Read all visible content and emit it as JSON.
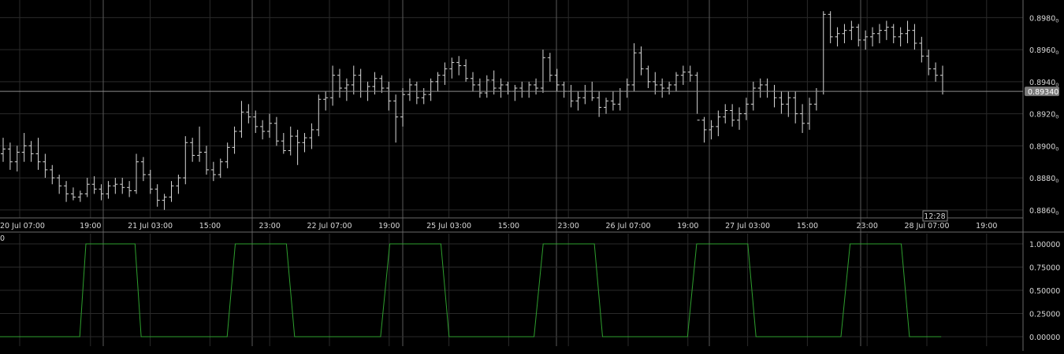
{
  "colors": {
    "background": "#000000",
    "grid": "#2a2a2a",
    "major_grid": "#5a5a5a",
    "bar": "#d8d8d8",
    "axis_text": "#d8d8d8",
    "indicator_line": "#2e9f2e",
    "price_tag_bg": "#7a7a7a",
    "crosshair": "#8a8a8a",
    "separator": "#6a6a6a"
  },
  "crosshair": {
    "price_label": "0.89340",
    "time_label": "12:28",
    "price": 0.8934
  },
  "price_panel": {
    "ylim": [
      0.8855,
      0.899
    ],
    "y_ticks": [
      "0.8980",
      "0.8960",
      "0.8940",
      "0.8920",
      "0.8900",
      "0.8880",
      "0.8860"
    ],
    "tick_suffix": "0"
  },
  "time_axis": {
    "labels": [
      "20 Jul 07:00",
      "19:00",
      "21 Jul 03:00",
      "15:00",
      "23:00",
      "22 Jul 07:00",
      "19:00",
      "25 Jul 03:00",
      "15:00",
      "23:00",
      "26 Jul 07:00",
      "19:00",
      "27 Jul 03:00",
      "15:00",
      "23:00",
      "28 Jul 07:00",
      "19:00"
    ]
  },
  "indicator_panel": {
    "corner_label": "0",
    "ylim": [
      0,
      1
    ],
    "y_ticks": [
      "1.00000",
      "0.75000",
      "0.50000",
      "0.25000",
      "0.00000"
    ]
  },
  "chart_data": [
    {
      "type": "line",
      "description": "OHLC bar chart",
      "bars_ohlc": [
        [
          0.8895,
          0.8905,
          0.889,
          0.8898
        ],
        [
          0.8898,
          0.8902,
          0.8885,
          0.889
        ],
        [
          0.889,
          0.89,
          0.8884,
          0.8896
        ],
        [
          0.8896,
          0.8908,
          0.889,
          0.89
        ],
        [
          0.89,
          0.8903,
          0.889,
          0.8895
        ],
        [
          0.8895,
          0.8905,
          0.8885,
          0.889
        ],
        [
          0.889,
          0.8895,
          0.888,
          0.8885
        ],
        [
          0.8885,
          0.8888,
          0.8876,
          0.888
        ],
        [
          0.888,
          0.8882,
          0.887,
          0.8875
        ],
        [
          0.8875,
          0.8878,
          0.8865,
          0.887
        ],
        [
          0.887,
          0.8874,
          0.8866,
          0.8868
        ],
        [
          0.8868,
          0.8872,
          0.8865,
          0.887
        ],
        [
          0.887,
          0.888,
          0.8868,
          0.8876
        ],
        [
          0.8876,
          0.8881,
          0.887,
          0.8873
        ],
        [
          0.8873,
          0.8876,
          0.8866,
          0.887
        ],
        [
          0.887,
          0.8878,
          0.8867,
          0.8875
        ],
        [
          0.8875,
          0.888,
          0.887,
          0.8876
        ],
        [
          0.8876,
          0.888,
          0.887,
          0.8874
        ],
        [
          0.8874,
          0.8878,
          0.8868,
          0.8872
        ],
        [
          0.8872,
          0.8895,
          0.887,
          0.889
        ],
        [
          0.889,
          0.8893,
          0.8878,
          0.8882
        ],
        [
          0.8882,
          0.8885,
          0.887,
          0.8873
        ],
        [
          0.8873,
          0.8876,
          0.8862,
          0.8866
        ],
        [
          0.8866,
          0.887,
          0.886,
          0.8868
        ],
        [
          0.8868,
          0.8878,
          0.8865,
          0.8875
        ],
        [
          0.8875,
          0.8882,
          0.887,
          0.888
        ],
        [
          0.888,
          0.8906,
          0.8876,
          0.8902
        ],
        [
          0.8902,
          0.8905,
          0.889,
          0.8894
        ],
        [
          0.8894,
          0.8912,
          0.889,
          0.8896
        ],
        [
          0.8896,
          0.89,
          0.8882,
          0.8885
        ],
        [
          0.8885,
          0.889,
          0.8878,
          0.8882
        ],
        [
          0.8882,
          0.8892,
          0.888,
          0.889
        ],
        [
          0.889,
          0.8902,
          0.8886,
          0.8899
        ],
        [
          0.8899,
          0.8912,
          0.8895,
          0.8909
        ],
        [
          0.8909,
          0.8928,
          0.8905,
          0.8921
        ],
        [
          0.8921,
          0.8926,
          0.8914,
          0.8918
        ],
        [
          0.8918,
          0.8922,
          0.8908,
          0.8912
        ],
        [
          0.8912,
          0.8916,
          0.8904,
          0.8909
        ],
        [
          0.8909,
          0.892,
          0.8905,
          0.8914
        ],
        [
          0.8914,
          0.8918,
          0.89,
          0.8903
        ],
        [
          0.8903,
          0.8908,
          0.8895,
          0.8897
        ],
        [
          0.8897,
          0.8912,
          0.8894,
          0.8906
        ],
        [
          0.8906,
          0.891,
          0.8888,
          0.8902
        ],
        [
          0.8902,
          0.8908,
          0.8896,
          0.8905
        ],
        [
          0.8905,
          0.8914,
          0.8898,
          0.891
        ],
        [
          0.891,
          0.8932,
          0.8906,
          0.8929
        ],
        [
          0.8929,
          0.8934,
          0.8922,
          0.893
        ],
        [
          0.893,
          0.895,
          0.8925,
          0.8944
        ],
        [
          0.8944,
          0.8948,
          0.893,
          0.8936
        ],
        [
          0.8936,
          0.8942,
          0.8928,
          0.8938
        ],
        [
          0.8938,
          0.895,
          0.8932,
          0.8944
        ],
        [
          0.8944,
          0.8948,
          0.893,
          0.8934
        ],
        [
          0.8934,
          0.894,
          0.8928,
          0.8937
        ],
        [
          0.8937,
          0.8946,
          0.8932,
          0.8942
        ],
        [
          0.8942,
          0.8944,
          0.8933,
          0.8936
        ],
        [
          0.8936,
          0.894,
          0.8922,
          0.8928
        ],
        [
          0.8928,
          0.8932,
          0.8902,
          0.8918
        ],
        [
          0.8918,
          0.8936,
          0.8912,
          0.8932
        ],
        [
          0.8932,
          0.8942,
          0.8928,
          0.8938
        ],
        [
          0.8938,
          0.894,
          0.8926,
          0.893
        ],
        [
          0.893,
          0.8936,
          0.8926,
          0.8932
        ],
        [
          0.8932,
          0.8942,
          0.8928,
          0.894
        ],
        [
          0.894,
          0.8946,
          0.8934,
          0.8944
        ],
        [
          0.8944,
          0.8952,
          0.8938,
          0.8948
        ],
        [
          0.8948,
          0.8955,
          0.8942,
          0.8952
        ],
        [
          0.8952,
          0.8956,
          0.8944,
          0.895
        ],
        [
          0.895,
          0.8954,
          0.894,
          0.8942
        ],
        [
          0.8942,
          0.8946,
          0.8934,
          0.8938
        ],
        [
          0.8938,
          0.8942,
          0.893,
          0.8933
        ],
        [
          0.8933,
          0.8944,
          0.893,
          0.8941
        ],
        [
          0.8941,
          0.8947,
          0.8932,
          0.8936
        ],
        [
          0.8936,
          0.8942,
          0.893,
          0.8938
        ],
        [
          0.8938,
          0.894,
          0.8932,
          0.8934
        ],
        [
          0.8934,
          0.8938,
          0.8928,
          0.8936
        ],
        [
          0.8936,
          0.894,
          0.893,
          0.8934
        ],
        [
          0.8934,
          0.894,
          0.893,
          0.8938
        ],
        [
          0.8938,
          0.8942,
          0.8932,
          0.8936
        ],
        [
          0.8936,
          0.896,
          0.8933,
          0.8955
        ],
        [
          0.8955,
          0.8958,
          0.894,
          0.8944
        ],
        [
          0.8944,
          0.8948,
          0.8934,
          0.8938
        ],
        [
          0.8938,
          0.894,
          0.893,
          0.8934
        ],
        [
          0.8934,
          0.8938,
          0.8924,
          0.8928
        ],
        [
          0.8928,
          0.8934,
          0.8922,
          0.893
        ],
        [
          0.893,
          0.8938,
          0.8926,
          0.8934
        ],
        [
          0.8934,
          0.894,
          0.8928,
          0.893
        ],
        [
          0.893,
          0.8934,
          0.8918,
          0.8924
        ],
        [
          0.8924,
          0.893,
          0.892,
          0.8928
        ],
        [
          0.8928,
          0.8934,
          0.8922,
          0.8926
        ],
        [
          0.8926,
          0.8936,
          0.8922,
          0.8934
        ],
        [
          0.8934,
          0.8942,
          0.893,
          0.8938
        ],
        [
          0.8938,
          0.8964,
          0.8934,
          0.8958
        ],
        [
          0.8958,
          0.8962,
          0.8944,
          0.8948
        ],
        [
          0.8948,
          0.895,
          0.8936,
          0.894
        ],
        [
          0.894,
          0.8946,
          0.8932,
          0.8938
        ],
        [
          0.8938,
          0.8942,
          0.893,
          0.8936
        ],
        [
          0.8936,
          0.894,
          0.8932,
          0.8938
        ],
        [
          0.8938,
          0.8946,
          0.8934,
          0.8944
        ],
        [
          0.8944,
          0.895,
          0.8938,
          0.8946
        ],
        [
          0.8946,
          0.895,
          0.894,
          0.8944
        ],
        [
          0.8944,
          0.8946,
          0.892,
          0.8916
        ],
        [
          0.8916,
          0.8918,
          0.8902,
          0.891
        ],
        [
          0.891,
          0.8916,
          0.8904,
          0.8912
        ],
        [
          0.8912,
          0.8922,
          0.8906,
          0.8918
        ],
        [
          0.8918,
          0.8926,
          0.8914,
          0.8922
        ],
        [
          0.8922,
          0.8926,
          0.8912,
          0.8916
        ],
        [
          0.8916,
          0.8924,
          0.891,
          0.892
        ],
        [
          0.892,
          0.893,
          0.8916,
          0.8926
        ],
        [
          0.8926,
          0.894,
          0.8922,
          0.8936
        ],
        [
          0.8936,
          0.8942,
          0.893,
          0.8938
        ],
        [
          0.8938,
          0.8942,
          0.893,
          0.8934
        ],
        [
          0.8934,
          0.8938,
          0.8924,
          0.893
        ],
        [
          0.893,
          0.8934,
          0.892,
          0.8926
        ],
        [
          0.8926,
          0.8934,
          0.8918,
          0.893
        ],
        [
          0.893,
          0.8934,
          0.8914,
          0.892
        ],
        [
          0.892,
          0.8926,
          0.8908,
          0.8914
        ],
        [
          0.8914,
          0.893,
          0.891,
          0.8926
        ],
        [
          0.8926,
          0.8936,
          0.8922,
          0.8934
        ],
        [
          0.8934,
          0.8984,
          0.8932,
          0.8982
        ],
        [
          0.8982,
          0.8984,
          0.8964,
          0.8968
        ],
        [
          0.8968,
          0.8974,
          0.8962,
          0.897
        ],
        [
          0.897,
          0.8976,
          0.8964,
          0.8972
        ],
        [
          0.8972,
          0.8978,
          0.8966,
          0.8974
        ],
        [
          0.8974,
          0.8976,
          0.8962,
          0.8966
        ],
        [
          0.8966,
          0.8972,
          0.896,
          0.8968
        ],
        [
          0.8968,
          0.8974,
          0.8962,
          0.897
        ],
        [
          0.897,
          0.8976,
          0.8964,
          0.8972
        ],
        [
          0.8972,
          0.8978,
          0.8966,
          0.8974
        ],
        [
          0.8974,
          0.8976,
          0.8964,
          0.8968
        ],
        [
          0.8968,
          0.8974,
          0.8962,
          0.897
        ],
        [
          0.897,
          0.8978,
          0.8964,
          0.8972
        ],
        [
          0.8972,
          0.8976,
          0.896,
          0.8964
        ],
        [
          0.8964,
          0.8968,
          0.8952,
          0.8956
        ],
        [
          0.8956,
          0.896,
          0.8944,
          0.8948
        ],
        [
          0.8948,
          0.8952,
          0.894,
          0.8944
        ],
        [
          0.8944,
          0.895,
          0.8932,
          0.8934
        ]
      ]
    },
    {
      "type": "line",
      "ylim": [
        0,
        1
      ],
      "x_fraction_points": [
        [
          0.0,
          0
        ],
        [
          0.078,
          0
        ],
        [
          0.084,
          1
        ],
        [
          0.132,
          1
        ],
        [
          0.138,
          0
        ],
        [
          0.222,
          0
        ],
        [
          0.23,
          1
        ],
        [
          0.28,
          1
        ],
        [
          0.288,
          0
        ],
        [
          0.372,
          0
        ],
        [
          0.381,
          1
        ],
        [
          0.431,
          1
        ],
        [
          0.439,
          0
        ],
        [
          0.522,
          0
        ],
        [
          0.531,
          1
        ],
        [
          0.581,
          1
        ],
        [
          0.589,
          0
        ],
        [
          0.672,
          0
        ],
        [
          0.681,
          1
        ],
        [
          0.731,
          1
        ],
        [
          0.739,
          0
        ],
        [
          0.822,
          0
        ],
        [
          0.831,
          1
        ],
        [
          0.881,
          1
        ],
        [
          0.889,
          0
        ],
        [
          0.92,
          0
        ]
      ]
    }
  ]
}
